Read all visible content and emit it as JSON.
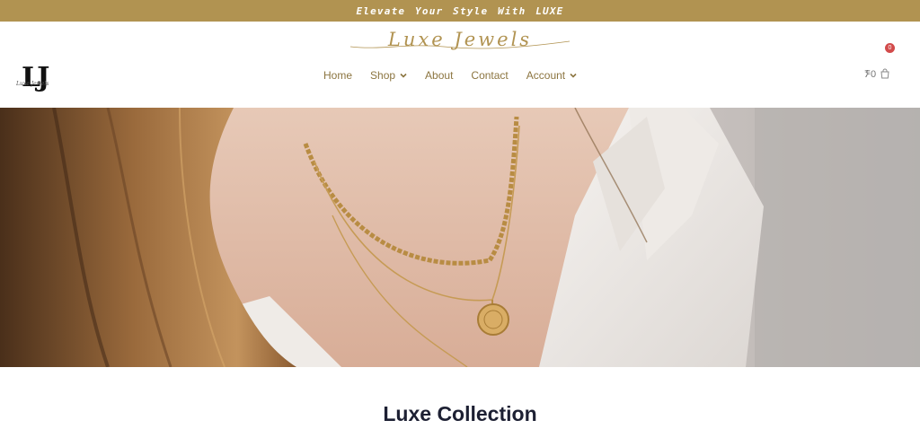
{
  "announcement": {
    "text": "Elevate Your Style With LUXE"
  },
  "brand": {
    "script_name": "Luxe Jewels",
    "monogram": "LJ",
    "monogram_script": "Luxe Jewels"
  },
  "nav": {
    "items": [
      {
        "label": "Home",
        "has_dropdown": false
      },
      {
        "label": "Shop",
        "has_dropdown": true
      },
      {
        "label": "About",
        "has_dropdown": false
      },
      {
        "label": "Contact",
        "has_dropdown": false
      },
      {
        "label": "Account",
        "has_dropdown": true
      }
    ]
  },
  "cart": {
    "amount": "0₹",
    "count": "0",
    "icon": "shopping-bag-icon"
  },
  "hero": {
    "image": "woman-wearing-gold-necklaces-photo"
  },
  "section": {
    "title": "Luxe Collection"
  },
  "colors": {
    "accent": "#b19351",
    "nav_text": "#8c7540",
    "heading": "#1d2033",
    "badge": "#d24b4b"
  }
}
